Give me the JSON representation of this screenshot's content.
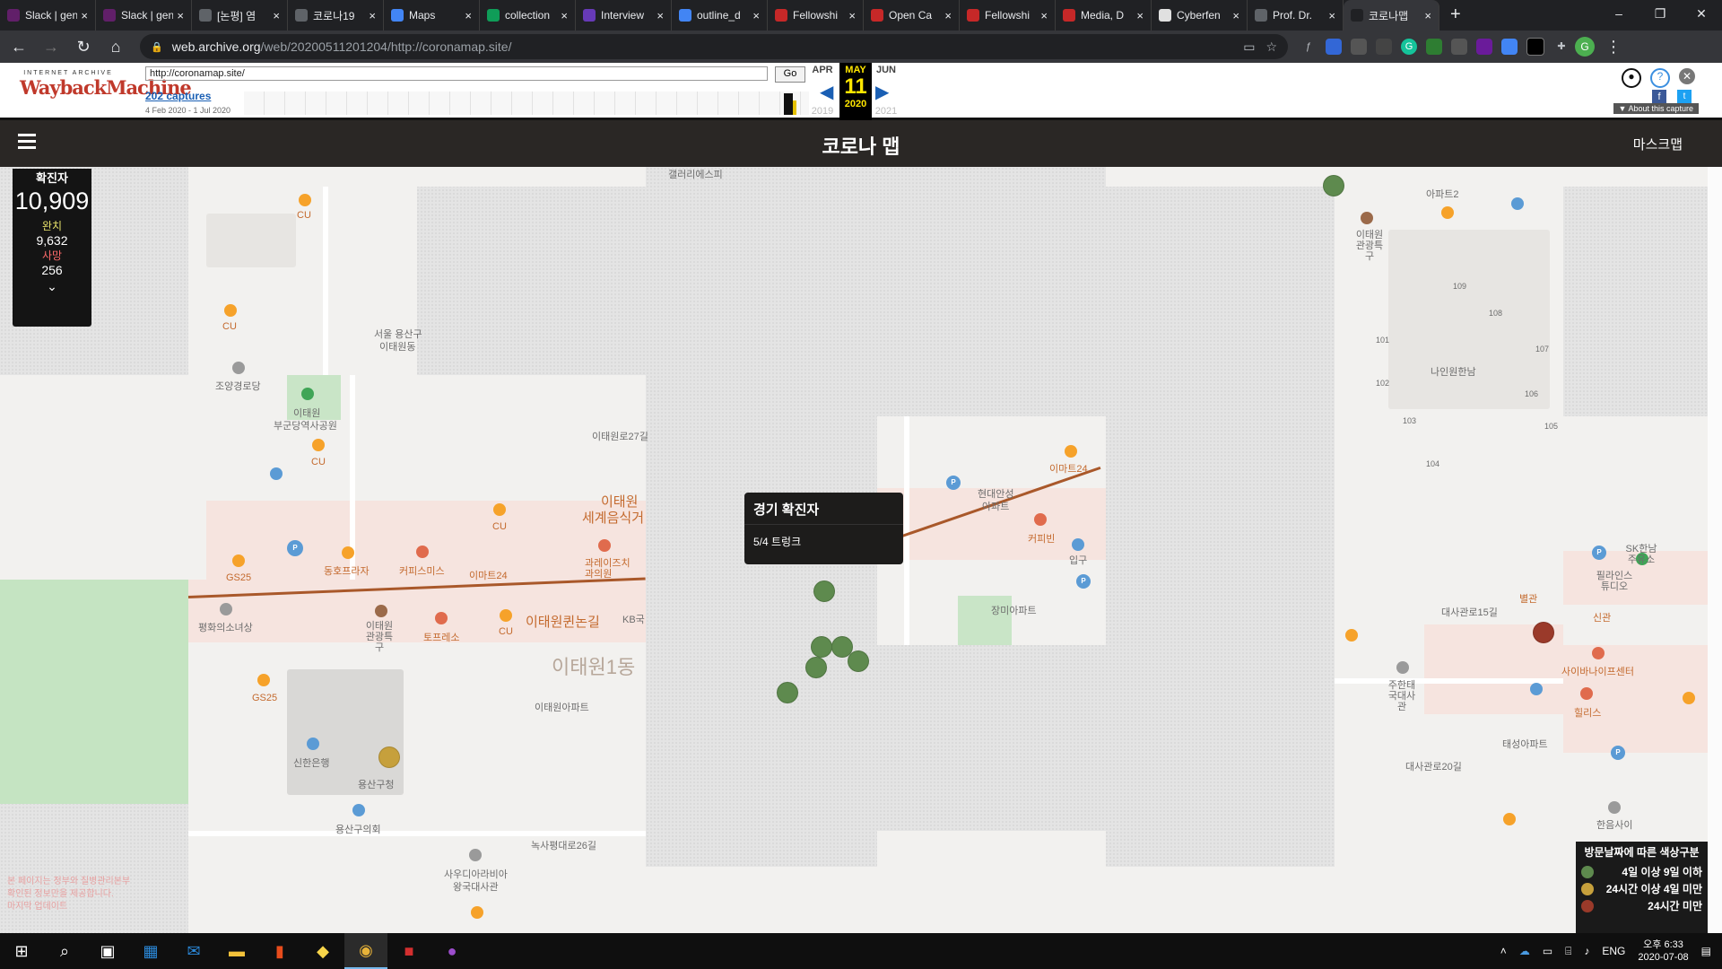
{
  "browser": {
    "tabs": [
      {
        "title": "Slack | gene",
        "favColor": "#611f69"
      },
      {
        "title": "Slack | gene",
        "favColor": "#611f69"
      },
      {
        "title": "[논평] 염",
        "favColor": "#5f6368"
      },
      {
        "title": "코로나19",
        "favColor": "#5f6368"
      },
      {
        "title": "Maps",
        "favColor": "#4285f4"
      },
      {
        "title": "collection",
        "favColor": "#0f9d58"
      },
      {
        "title": "Interview",
        "favColor": "#673ab7"
      },
      {
        "title": "outline_d",
        "favColor": "#4285f4"
      },
      {
        "title": "Fellowshi",
        "favColor": "#c62828"
      },
      {
        "title": "Open Ca",
        "favColor": "#c62828"
      },
      {
        "title": "Fellowshi",
        "favColor": "#c62828"
      },
      {
        "title": "Media, D",
        "favColor": "#c62828"
      },
      {
        "title": "Cyberfen",
        "favColor": "#e0e0e0"
      },
      {
        "title": "Prof. Dr.",
        "favColor": "#5f6368"
      },
      {
        "title": "코로나맵",
        "favColor": "#202124"
      }
    ],
    "new_tab": "+",
    "window_controls": {
      "minimize": "–",
      "maximize": "❐",
      "close": "✕"
    },
    "url_host": "web.archive.org",
    "url_path": "/web/20200511201204/http://coronamap.site/",
    "profile_initial": "G"
  },
  "wayback": {
    "logo_top": "INTERNET ARCHIVE",
    "logo_main": "WaybackMachine",
    "url_value": "http://coronamap.site/",
    "go": "Go",
    "captures": "202 captures",
    "range": "4 Feb 2020 - 1 Jul 2020",
    "prev_month": "APR",
    "cur_month": "MAY",
    "next_month": "JUN",
    "day": "11",
    "prev_year": "2019",
    "cur_year": "2020",
    "next_year": "2021",
    "about": "▼ About this capture"
  },
  "site": {
    "title": "코로나 맵",
    "right_link": "마스크맵"
  },
  "stats": {
    "confirmed_label": "확진자",
    "confirmed": "10,909",
    "recovered_label": "완치",
    "recovered": "9,632",
    "deaths_label": "사망",
    "deaths": "256",
    "expand": "⌄"
  },
  "popup": {
    "title": "경기 확진자",
    "body": "5/4 트렁크"
  },
  "legend": {
    "title": "방문날짜에 따른 색상구분",
    "items": [
      {
        "label": "4일 이상 9일 이하",
        "color": "#5e8a4e"
      },
      {
        "label": "24시간 이상 4일 미만",
        "color": "#c6a03c"
      },
      {
        "label": "24시간 미만",
        "color": "#9a3a2a"
      }
    ]
  },
  "map_labels": {
    "gallery": "갤러리에스피",
    "seoul_yongsan": "서울 용산구",
    "itaewon_dong": "이태원동",
    "choyang": "조양경로당",
    "itaewon_park": "이태원",
    "park2": "부군당역사공원",
    "cu": "CU",
    "gs25": "GS25",
    "itaewon_big": "이태원",
    "world_food": "세계음식거",
    "dongho": "동호프라자",
    "coffee_smith": "커피스미스",
    "emart24": "이마트24",
    "chicken": "과레이즈치과의원",
    "special": "이태원관광특구",
    "peace": "평화의소녀상",
    "tours": "토프레소",
    "queen": "이태원퀸논길",
    "kb": "KB국",
    "area_1": "이태원1동",
    "apt": "이태원아파트",
    "shinhan": "신한은행",
    "yongsan_office": "용산구청",
    "yongsan_council": "용산구의회",
    "saudi": "사우디아라비아",
    "saudi2": "왕국대사관",
    "hyundai": "현대안성",
    "hyundai2": "아파트",
    "coffee_bean": "커피빈",
    "rose": "장미아파트",
    "entry": "입구",
    "nine_one": "나인원한남",
    "itaewon_tour": "이태원관광특구",
    "sk": "SK한남주유소",
    "filline": "필라인스튜디오",
    "biane": "사이바나이프센터",
    "alice": "힐리스",
    "taesung": "태성아파트",
    "oman": "주한태국대사관",
    "hanum": "한음사이",
    "sinkwan": "신관",
    "byulgwan": "별관",
    "daesa15": "대사관로15길",
    "daesa20": "대사관로20길",
    "itaewonro27": "이태원로27길",
    "noksapyeong": "녹사평대로26길",
    "apt2": "아파트2"
  },
  "notice": {
    "line1": "본 페이지는 정부와 질병관리본부",
    "line2": "확인된 정보만을 제공합니다.",
    "line3": "마지막 업데이트"
  },
  "taskbar": {
    "time": "오후 6:33",
    "date": "2020-07-08",
    "lang": "ENG"
  }
}
